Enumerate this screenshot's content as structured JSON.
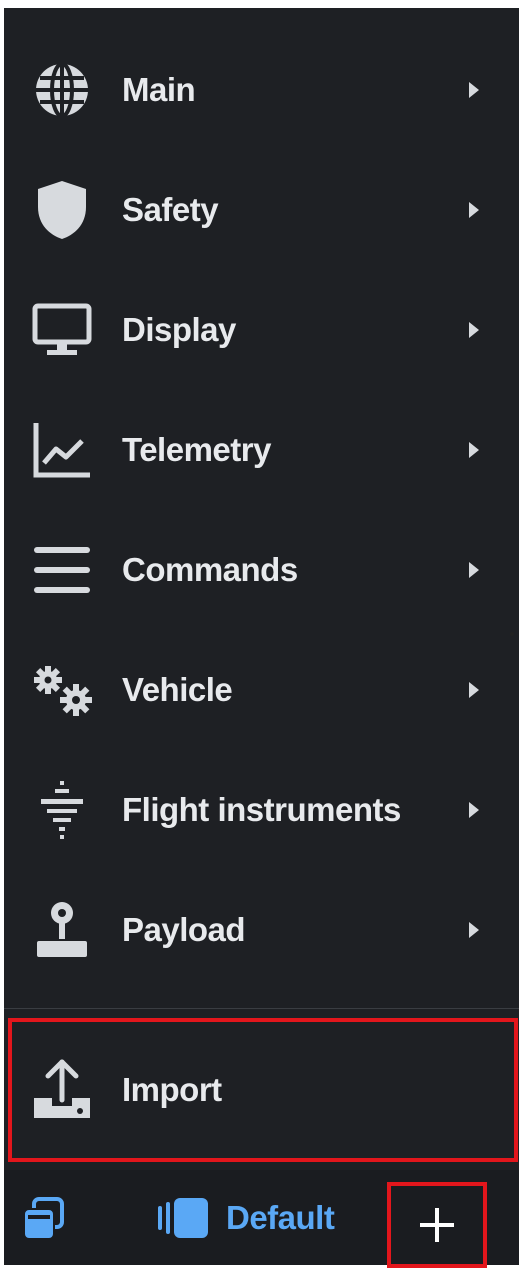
{
  "menu": {
    "items": [
      {
        "label": "Main",
        "icon": "globe-icon"
      },
      {
        "label": "Safety",
        "icon": "shield-icon"
      },
      {
        "label": "Display",
        "icon": "monitor-icon"
      },
      {
        "label": "Telemetry",
        "icon": "line-chart-icon"
      },
      {
        "label": "Commands",
        "icon": "menu-lines-icon"
      },
      {
        "label": "Vehicle",
        "icon": "gears-icon"
      },
      {
        "label": "Flight instruments",
        "icon": "attitude-indicator-icon"
      },
      {
        "label": "Payload",
        "icon": "joystick-icon"
      }
    ]
  },
  "import": {
    "label": "Import",
    "icon": "upload-icon"
  },
  "bottom_bar": {
    "left_icon": "windows-stack-icon",
    "profile_label": "Default",
    "profile_icon": "view-columns-icon",
    "add_icon": "plus-icon"
  },
  "colors": {
    "panel_bg": "#1e2024",
    "text": "#e8eaed",
    "icon": "#d7dade",
    "accent_blue": "#5aa8f5",
    "highlight_red": "#e3161c"
  }
}
